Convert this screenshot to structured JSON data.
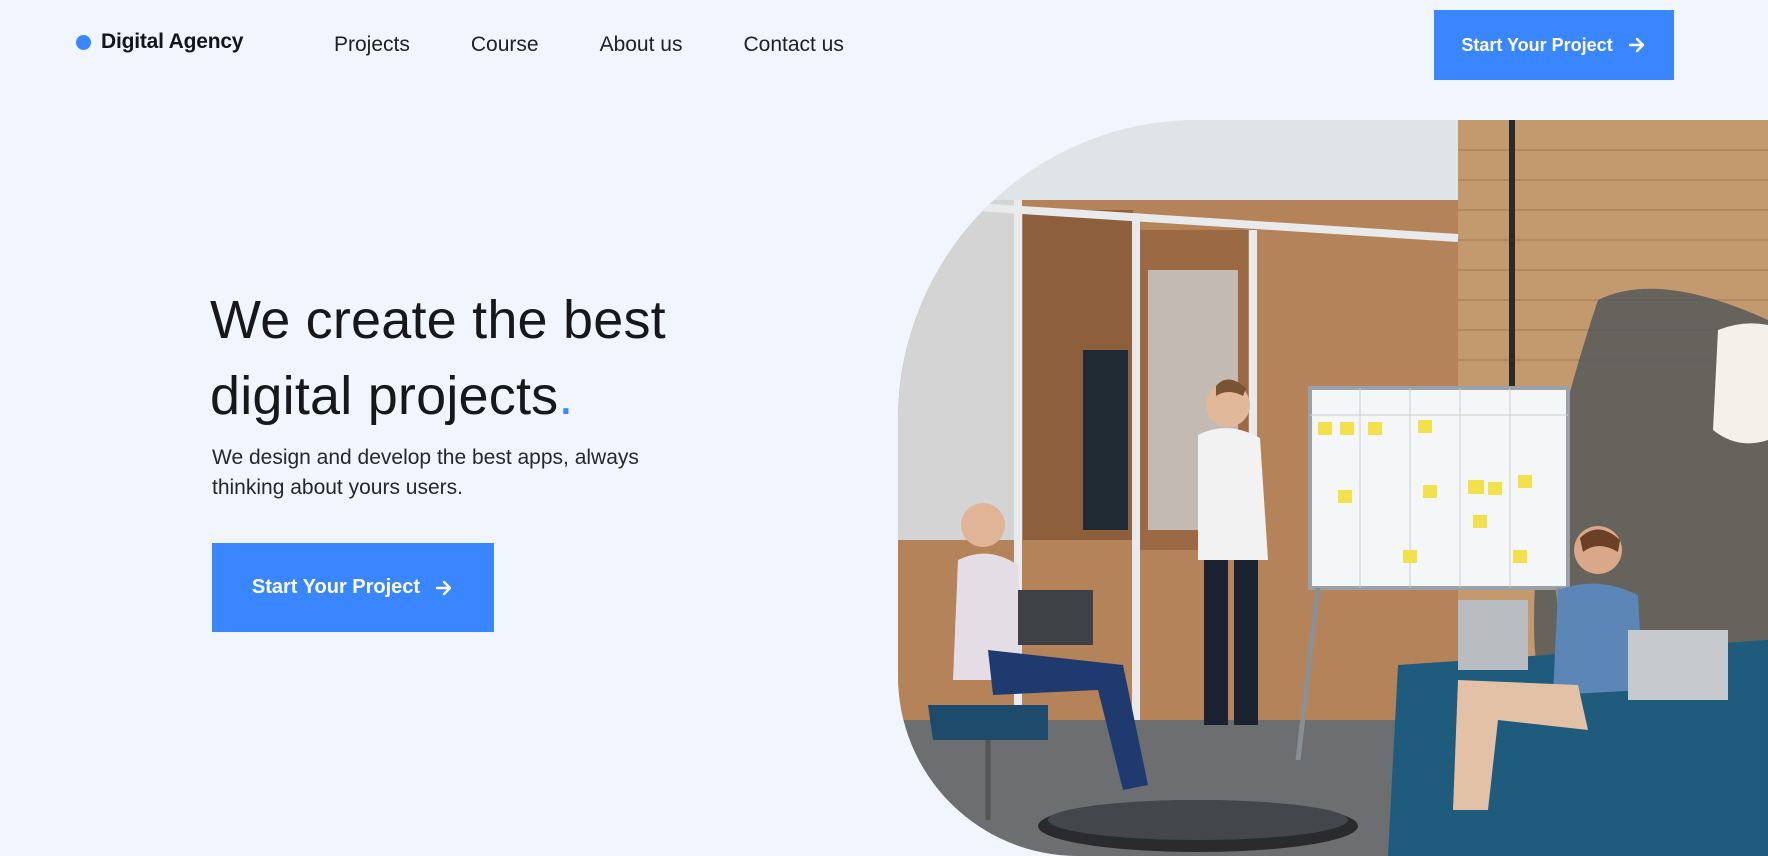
{
  "brand": {
    "name": "Digital Agency",
    "accent_color": "#3a86ff"
  },
  "nav": {
    "links": [
      {
        "label": "Projects"
      },
      {
        "label": "Course"
      },
      {
        "label": "About us"
      },
      {
        "label": "Contact us"
      }
    ],
    "cta_label": "Start Your Project",
    "cta_icon": "arrow-right-icon"
  },
  "hero": {
    "title_line1": "We create the best",
    "title_line2": "digital projects",
    "title_dot": ".",
    "subtitle": "We design and develop the best apps, always thinking about yours users.",
    "cta_label": "Start Your Project",
    "cta_icon": "arrow-right-icon",
    "image_subject": "team-meeting-photo"
  }
}
